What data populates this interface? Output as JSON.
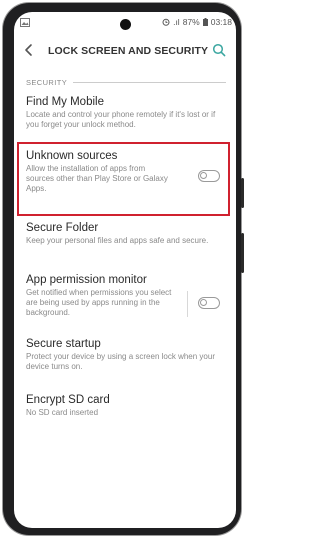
{
  "status_bar": {
    "signal": ".ıl",
    "battery_percent": "87%",
    "time": "03:18"
  },
  "header": {
    "title": "LOCK SCREEN AND SECURITY",
    "back_icon": "chevron-left-icon",
    "search_icon": "search-icon"
  },
  "section": {
    "label": "SECURITY"
  },
  "items": [
    {
      "title": "Find My Mobile",
      "description": "Locate and control your phone remotely if it's lost or if you forget your unlock method.",
      "has_toggle": false
    },
    {
      "title": "Unknown sources",
      "description": "Allow the installation of apps from sources other than Play Store or Galaxy Apps.",
      "has_toggle": true,
      "toggle_on": false,
      "highlighted": true
    },
    {
      "title": "Secure Folder",
      "description": "Keep your personal files and apps safe and secure.",
      "has_toggle": false
    },
    {
      "title": "App permission monitor",
      "description": "Get notified when permissions you select are being used by apps running in the background.",
      "has_toggle": true,
      "toggle_on": false
    },
    {
      "title": "Secure startup",
      "description": "Protect your device by using a screen lock when your device turns on.",
      "has_toggle": false
    },
    {
      "title": "Encrypt SD card",
      "description": "No SD card inserted",
      "has_toggle": false
    }
  ],
  "colors": {
    "highlight_border": "#d0212f",
    "accent": "#3aa6a0"
  }
}
